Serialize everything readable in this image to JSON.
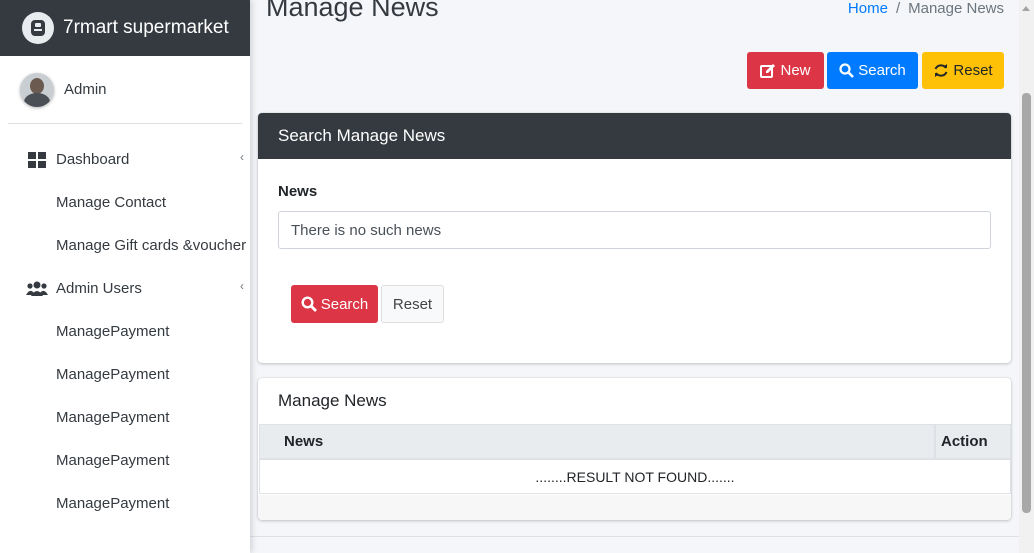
{
  "brand": {
    "name": "7rmart supermarket",
    "logo_icon": "brand-logo-icon"
  },
  "user": {
    "name": "Admin"
  },
  "sidebar": {
    "items": [
      {
        "label": "Dashboard",
        "icon": "dashboard-grid-icon",
        "level": "top"
      },
      {
        "label": "Manage Contact",
        "level": "sub"
      },
      {
        "label": "Manage Gift cards &voucher",
        "level": "sub"
      },
      {
        "label": "Admin Users",
        "icon": "users-icon",
        "level": "top"
      },
      {
        "label": "ManagePayment",
        "level": "sub"
      },
      {
        "label": "ManagePayment",
        "level": "sub"
      },
      {
        "label": "ManagePayment",
        "level": "sub"
      },
      {
        "label": "ManagePayment",
        "level": "sub"
      },
      {
        "label": "ManagePayment",
        "level": "sub"
      }
    ]
  },
  "header": {
    "title": "Manage News",
    "breadcrumb": {
      "home": "Home",
      "separator": "/",
      "current": "Manage News"
    }
  },
  "toolbar": {
    "new_label": "New",
    "search_label": "Search",
    "reset_label": "Reset"
  },
  "search_card": {
    "title": "Search Manage News",
    "field_label": "News",
    "field_value": "There is no such news",
    "search_button": "Search",
    "reset_button": "Reset"
  },
  "results_card": {
    "title": "Manage News",
    "columns": [
      "News",
      "Action"
    ],
    "empty_message": "........RESULT NOT FOUND......."
  },
  "colors": {
    "sidebar_header": "#343a40",
    "danger": "#dc3545",
    "primary": "#007bff",
    "warning": "#ffc107"
  }
}
